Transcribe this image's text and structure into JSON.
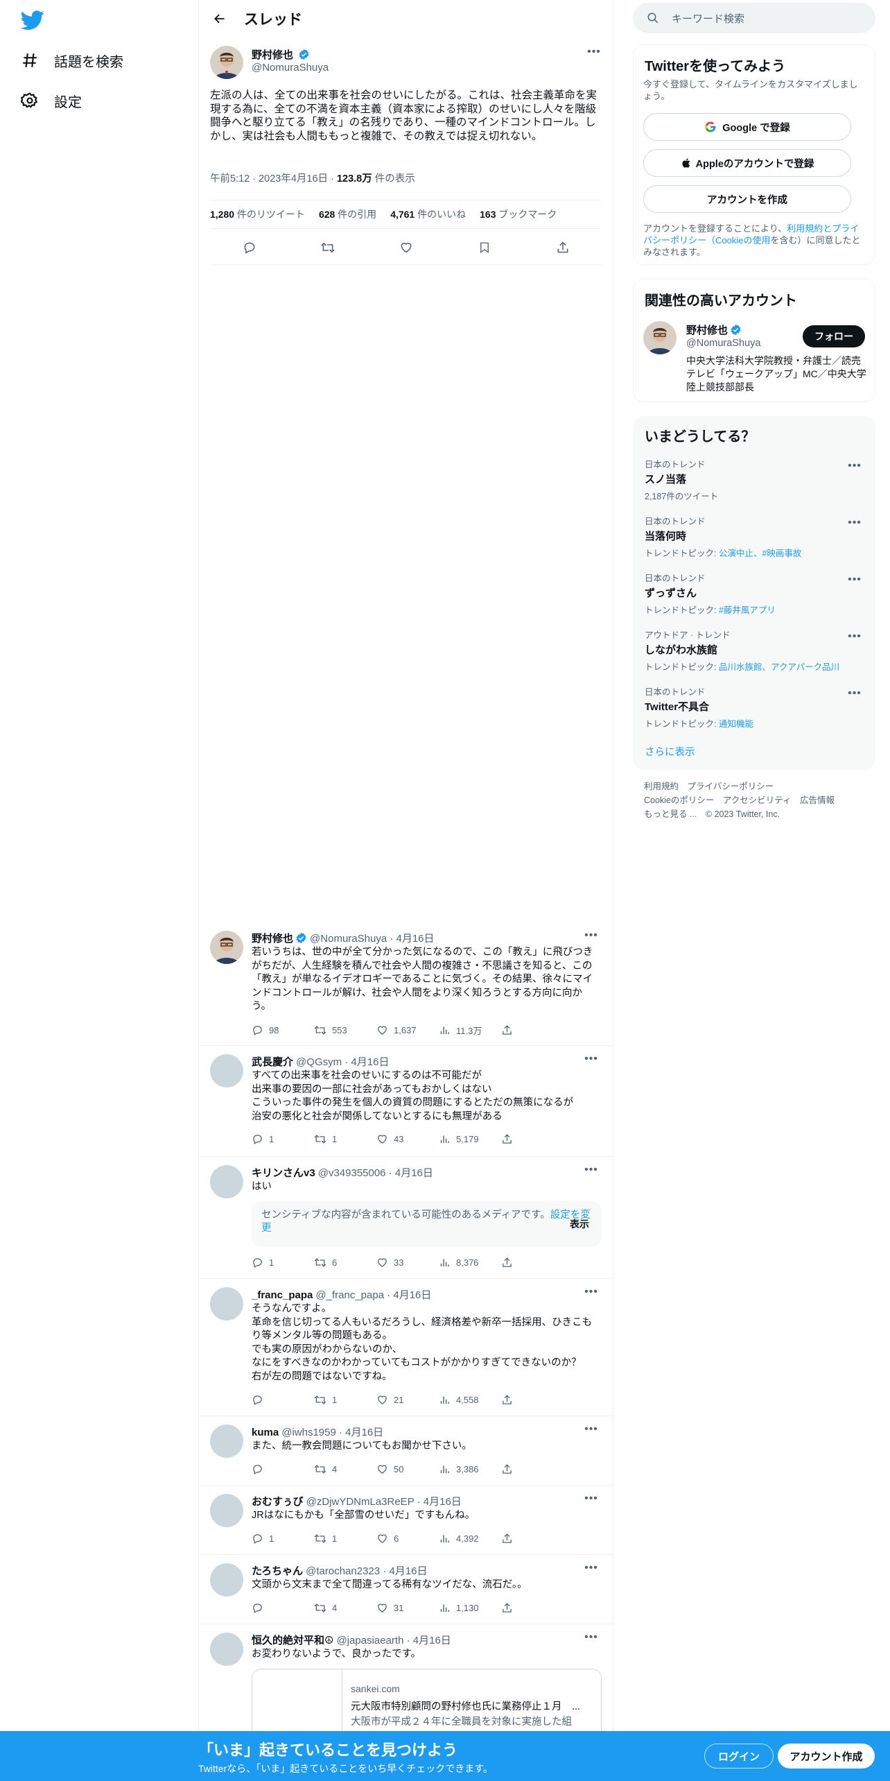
{
  "nav": {
    "explore_label": "話題を検索",
    "settings_label": "設定"
  },
  "header": {
    "title": "スレッド"
  },
  "main_tweet": {
    "name": "野村修也",
    "handle": "@NomuraShuya",
    "text": "左派の人は、全ての出来事を社会のせいにしたがる。これは、社会主義革命を実現する為に、全ての不満を資本主義（資本家による搾取）のせいにし人々を階級闘争へと駆り立てる「教え」の名残りであり、一種のマインドコントロール。しかし、実は社会も人間ももっと複雑で、その教えでは捉え切れない。",
    "time": "午前5:12 · 2023年4月16日 · ",
    "views": "123.8万",
    "views_label": " 件の表示",
    "retweets": "1,280",
    "retweets_label": " 件のリツイート",
    "quotes": "628",
    "quotes_label": " 件の引用",
    "likes": "4,761",
    "likes_label": " 件のいいね",
    "bookmarks": "163",
    "bookmarks_label": " ブックマーク"
  },
  "replies": [
    {
      "name": "野村修也",
      "handle": "@NomuraShuya · 4月16日",
      "text": "若いうちは、世の中が全て分かった気になるので、この「教え」に飛びつきがちだが、人生経験を積んで社会や人間の複雑さ・不思議さを知ると、この「教え」が単なるイデオロギーであることに気づく。その結果、徐々にマインドコントロールが解け、社会や人間をより深く知ろうとする方向に向かう。",
      "reply": "98",
      "rt": "553",
      "like": "1,637",
      "views": "11.3万"
    },
    {
      "name": "武長慶介",
      "handle": "@QGsym · 4月16日",
      "text": "すべての出来事を社会のせいにするのは不可能だが\n出来事の要因の一部に社会があってもおかしくはない\nこういった事件の発生を個人の資質の問題にするとただの無策になるが\n治安の悪化と社会が関係してないとするにも無理がある",
      "reply": "1",
      "rt": "1",
      "like": "43",
      "views": "5,179"
    },
    {
      "name": "キリンさんv3",
      "handle": "@v349355006 · 4月16日",
      "text": "はい",
      "reply": "1",
      "rt": "6",
      "like": "33",
      "views": "8,376",
      "sensitive": "センシティブな内容が含まれている可能性のあるメディアです。",
      "sensitive_link": "設定を変更",
      "sensitive_show": "表示"
    },
    {
      "name": "_franc_papa",
      "handle": "@_franc_papa · 4月16日",
      "text": "そうなんですよ。\n革命を信じ切ってる人もいるだろうし、経済格差や新卒一括採用、ひきこもり等メンタル等の問題もある。\nでも実の原因がわからないのか、\nなにをすべきなのかわかっていてもコストがかかりすぎてできないのか？\n右が左の問題ではないですね。",
      "reply": "",
      "rt": "1",
      "like": "21",
      "views": "4,558"
    },
    {
      "name": "kuma",
      "handle": "@iwhs1959 · 4月16日",
      "text": "また、統一教会問題についてもお聞かせ下さい。",
      "reply": "",
      "rt": "4",
      "like": "50",
      "views": "3,386"
    },
    {
      "name": "おむすぅび",
      "handle": "@zDjwYDNmLa3ReEP · 4月16日",
      "text": "JRはなにもかも「全部雪のせいだ」ですもんね。",
      "reply": "1",
      "rt": "1",
      "like": "6",
      "views": "4,392"
    },
    {
      "name": "たろちゃん",
      "handle": "@tarochan2323 · 4月16日",
      "text": "文頭から文末まで全て間違ってる稀有なツイだな、流石だ。。",
      "reply": "",
      "rt": "4",
      "like": "31",
      "views": "1,130"
    },
    {
      "name": "恒久的絶対平和☮",
      "handle": "@japasiaearth · 4月16日",
      "text": "お変わりないようで、良かったです。",
      "card_domain": "sankei.com",
      "card_title": "元大阪市特別顧問の野村修也氏に業務停止１月　...",
      "card_desc": "大阪市が平成２４年に全職員を対象に実施した組"
    }
  ],
  "sidebar": {
    "search_placeholder": "キーワード検索",
    "signup_title": "Twitterを使ってみよう",
    "signup_desc": "今すぐ登録して、タイムラインをカスタマイズしましょう。",
    "google_btn": "Google で登録",
    "apple_btn": "Appleのアカウントで登録",
    "create_btn": "アカウントを作成",
    "terms_pre": "アカウントを登録することにより、",
    "terms_link": "利用規約とプライバシーポリシー（Cookieの使用",
    "terms_post": "を含む）に同意したとみなされます。",
    "related_title": "関連性の高いアカウント",
    "related_name": "野村修也",
    "related_handle": "@NomuraShuya",
    "follow_btn": "フォロー",
    "related_bio": "中央大学法科大学院教授・弁護士／読売テレビ「ウェークアップ」MC／中央大学陸上競技部部長",
    "trends_title": "いまどうしてる？",
    "trends": [
      {
        "cat": "日本のトレンド",
        "title": "スノ当落",
        "sub": "2,187件のツイート",
        "topics": ""
      },
      {
        "cat": "日本のトレンド",
        "title": "当落何時",
        "sub": "トレンドトピック: ",
        "topics": "公演中止、#映画事故"
      },
      {
        "cat": "日本のトレンド",
        "title": "ずっずさん",
        "sub": "トレンドトピック: ",
        "topics": "#藤井風アプリ"
      },
      {
        "cat": "アウトドア · トレンド",
        "title": "しながわ水族館",
        "sub": "トレンドトピック: ",
        "topics": "品川水族館、アクアパーク品川"
      },
      {
        "cat": "日本のトレンド",
        "title": "Twitter不具合",
        "sub": "トレンドトピック: ",
        "topics": "通知機能"
      }
    ],
    "show_more": "さらに表示",
    "footer_line1": "利用規約　プライバシーポリシー",
    "footer_line2": "Cookieのポリシー　アクセシビリティ　広告情報",
    "footer_line3": "もっと見る ...　© 2023 Twitter, Inc."
  },
  "bottom": {
    "title": "「いま」起きていることを見つけよう",
    "subtitle": "Twitterなら、「いま」起きていることをいち早くチェックできます。",
    "login": "ログイン",
    "signup": "アカウント作成"
  },
  "colors": {
    "accent": "#1d9bf0",
    "verified": "#1d9bf0"
  }
}
